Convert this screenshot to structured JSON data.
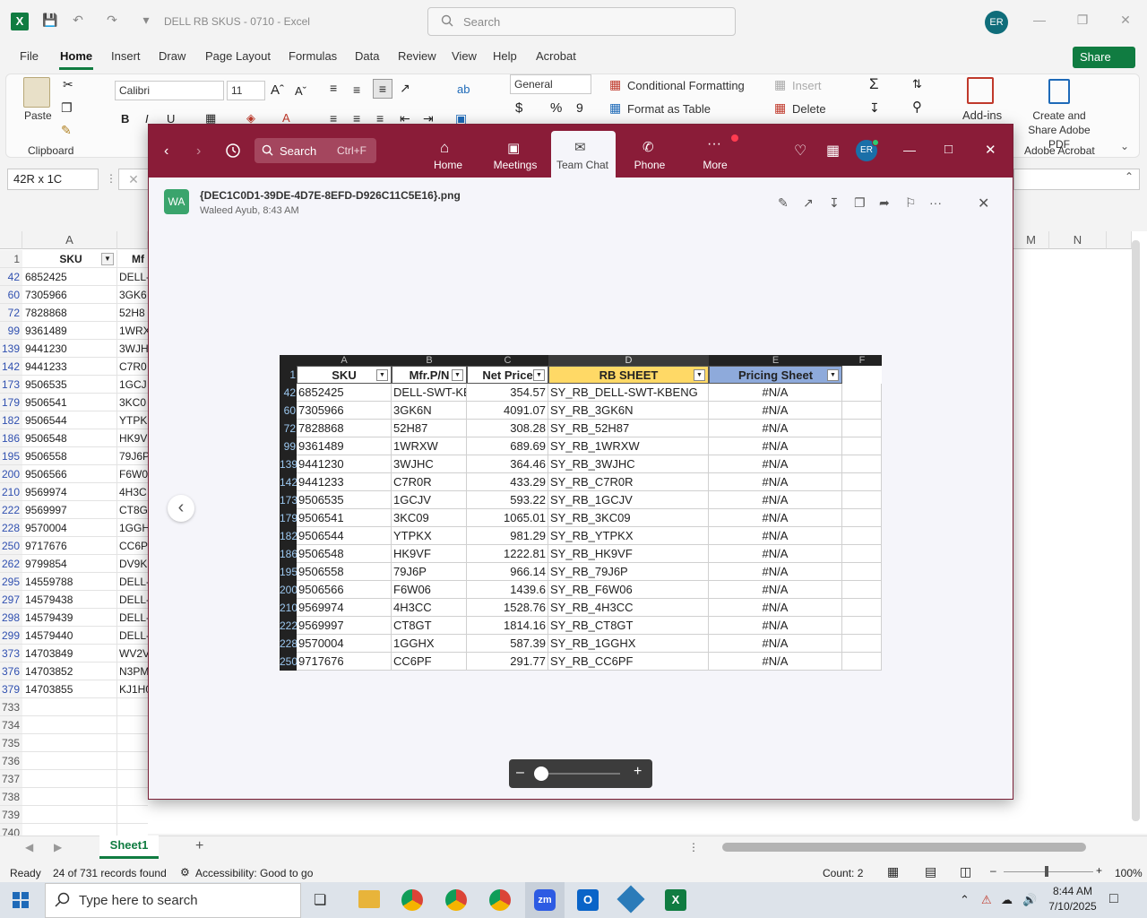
{
  "excel": {
    "doc_title": "DELL RB SKUS - 0710  -  Excel",
    "search_placeholder": "Search",
    "avatar": "ER",
    "tabs": [
      "File",
      "Home",
      "Insert",
      "Draw",
      "Page Layout",
      "Formulas",
      "Data",
      "Review",
      "View",
      "Help",
      "Acrobat"
    ],
    "share": "Share",
    "ribbon": {
      "paste": "Paste",
      "clipboard": "Clipboard",
      "font": "Calibri",
      "size": "11",
      "number_format": "General",
      "cond_format": "Conditional Formatting",
      "format_table": "Format as Table",
      "insert": "Insert",
      "delete": "Delete",
      "addins": "Add-ins",
      "create_pdf": "Create and Share Adobe PDF",
      "adobe_acrobat": "Adobe Acrobat"
    },
    "namebox": "42R x 1C",
    "columns": {
      "a": "A",
      "b": "Mf",
      "m": "M",
      "n": "N"
    },
    "header_row": {
      "num": "1",
      "sku": "SKU"
    },
    "rows": [
      {
        "r": "42",
        "a": "6852425",
        "b": "DELL-"
      },
      {
        "r": "60",
        "a": "7305966",
        "b": "3GK6"
      },
      {
        "r": "72",
        "a": "7828868",
        "b": "52H8"
      },
      {
        "r": "99",
        "a": "9361489",
        "b": "1WRX"
      },
      {
        "r": "139",
        "a": "9441230",
        "b": "3WJH"
      },
      {
        "r": "142",
        "a": "9441233",
        "b": "C7R0"
      },
      {
        "r": "173",
        "a": "9506535",
        "b": "1GCJ"
      },
      {
        "r": "179",
        "a": "9506541",
        "b": "3KC0"
      },
      {
        "r": "182",
        "a": "9506544",
        "b": "YTPK"
      },
      {
        "r": "186",
        "a": "9506548",
        "b": "HK9V"
      },
      {
        "r": "195",
        "a": "9506558",
        "b": "79J6P"
      },
      {
        "r": "200",
        "a": "9506566",
        "b": "F6W0"
      },
      {
        "r": "210",
        "a": "9569974",
        "b": "4H3C"
      },
      {
        "r": "222",
        "a": "9569997",
        "b": "CT8G"
      },
      {
        "r": "228",
        "a": "9570004",
        "b": "1GGH"
      },
      {
        "r": "250",
        "a": "9717676",
        "b": "CC6P"
      },
      {
        "r": "262",
        "a": "9799854",
        "b": "DV9K"
      },
      {
        "r": "295",
        "a": "14559788",
        "b": "DELL-"
      },
      {
        "r": "297",
        "a": "14579438",
        "b": "DELL-"
      },
      {
        "r": "298",
        "a": "14579439",
        "b": "DELL-"
      },
      {
        "r": "299",
        "a": "14579440",
        "b": "DELL-"
      },
      {
        "r": "373",
        "a": "14703849",
        "b": "WV2V"
      },
      {
        "r": "376",
        "a": "14703852",
        "b": "N3PM"
      },
      {
        "r": "379",
        "a": "14703855",
        "b": "KJ1H0"
      }
    ],
    "empty_rows": [
      "733",
      "734",
      "735",
      "736",
      "737",
      "738",
      "739",
      "740"
    ],
    "sheet_tab": "Sheet1",
    "status": {
      "ready": "Ready",
      "records": "24 of 731 records found",
      "accessibility": "Accessibility: Good to go",
      "count": "Count: 2",
      "zoom": "100%"
    }
  },
  "teams": {
    "search": "Search",
    "shortcut": "Ctrl+F",
    "nav": [
      "Home",
      "Meetings",
      "Team Chat",
      "Phone",
      "More"
    ],
    "avatar": "ER",
    "file_avatar": "WA",
    "file_name": "{DEC1C0D1-39DE-4D7E-8EFD-D926C11C5E16}.png",
    "file_sub": "Waleed Ayub, 8:43 AM",
    "image": {
      "cols": [
        "A",
        "B",
        "C",
        "D",
        "E",
        "F"
      ],
      "headers": {
        "num": "1",
        "sku": "SKU",
        "mfr": "Mfr.P/N",
        "price": "Net Price",
        "rb": "RB SHEET",
        "pricing": "Pricing Sheet"
      },
      "rows": [
        {
          "r": "42",
          "sku": "6852425",
          "mfr": "DELL-SWT-KB",
          "price": "354.57",
          "rb": "SY_RB_DELL-SWT-KBENG",
          "ps": "#N/A"
        },
        {
          "r": "60",
          "sku": "7305966",
          "mfr": "3GK6N",
          "price": "4091.07",
          "rb": "SY_RB_3GK6N",
          "ps": "#N/A"
        },
        {
          "r": "72",
          "sku": "7828868",
          "mfr": "52H87",
          "price": "308.28",
          "rb": "SY_RB_52H87",
          "ps": "#N/A"
        },
        {
          "r": "99",
          "sku": "9361489",
          "mfr": "1WRXW",
          "price": "689.69",
          "rb": "SY_RB_1WRXW",
          "ps": "#N/A"
        },
        {
          "r": "139",
          "sku": "9441230",
          "mfr": "3WJHC",
          "price": "364.46",
          "rb": "SY_RB_3WJHC",
          "ps": "#N/A"
        },
        {
          "r": "142",
          "sku": "9441233",
          "mfr": "C7R0R",
          "price": "433.29",
          "rb": "SY_RB_C7R0R",
          "ps": "#N/A"
        },
        {
          "r": "173",
          "sku": "9506535",
          "mfr": "1GCJV",
          "price": "593.22",
          "rb": "SY_RB_1GCJV",
          "ps": "#N/A"
        },
        {
          "r": "179",
          "sku": "9506541",
          "mfr": "3KC09",
          "price": "1065.01",
          "rb": "SY_RB_3KC09",
          "ps": "#N/A"
        },
        {
          "r": "182",
          "sku": "9506544",
          "mfr": "YTPKX",
          "price": "981.29",
          "rb": "SY_RB_YTPKX",
          "ps": "#N/A"
        },
        {
          "r": "186",
          "sku": "9506548",
          "mfr": "HK9VF",
          "price": "1222.81",
          "rb": "SY_RB_HK9VF",
          "ps": "#N/A"
        },
        {
          "r": "195",
          "sku": "9506558",
          "mfr": "79J6P",
          "price": "966.14",
          "rb": "SY_RB_79J6P",
          "ps": "#N/A"
        },
        {
          "r": "200",
          "sku": "9506566",
          "mfr": "F6W06",
          "price": "1439.6",
          "rb": "SY_RB_F6W06",
          "ps": "#N/A"
        },
        {
          "r": "210",
          "sku": "9569974",
          "mfr": "4H3CC",
          "price": "1528.76",
          "rb": "SY_RB_4H3CC",
          "ps": "#N/A"
        },
        {
          "r": "222",
          "sku": "9569997",
          "mfr": "CT8GT",
          "price": "1814.16",
          "rb": "SY_RB_CT8GT",
          "ps": "#N/A"
        },
        {
          "r": "228",
          "sku": "9570004",
          "mfr": "1GGHX",
          "price": "587.39",
          "rb": "SY_RB_1GGHX",
          "ps": "#N/A"
        },
        {
          "r": "250",
          "sku": "9717676",
          "mfr": "CC6PF",
          "price": "291.77",
          "rb": "SY_RB_CC6PF",
          "ps": "#N/A"
        }
      ]
    }
  },
  "taskbar": {
    "search_placeholder": "Type here to search",
    "time": "8:44 AM",
    "date": "7/10/2025"
  },
  "colors": {
    "excel_green": "#107c41",
    "teams_bar": "#8a1c38",
    "rb_header": "#ffd966",
    "pricing_header": "#8eaadb"
  }
}
